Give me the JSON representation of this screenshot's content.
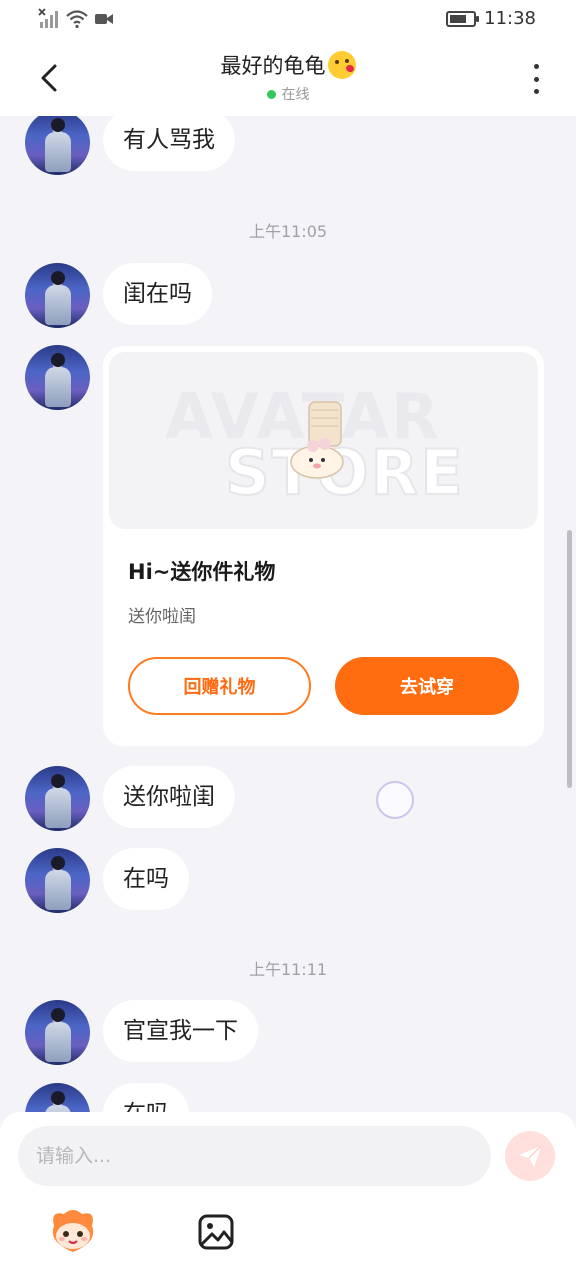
{
  "status_bar": {
    "time": "11:38"
  },
  "header": {
    "title": "最好的龟龟",
    "status": "在线"
  },
  "messages": [
    {
      "text": "有人骂我"
    },
    {
      "time": "上午11:05"
    },
    {
      "text": "闺在吗"
    },
    {
      "gift": {
        "title": "Hi~送你件礼物",
        "message": "送你啦闺",
        "return_label": "回赠礼物",
        "try_label": "去试穿",
        "watermark_top": "AVATAR",
        "watermark_bottom": "STORE"
      }
    },
    {
      "text": "送你啦闺"
    },
    {
      "text": "在吗"
    },
    {
      "time": "上午11:11"
    },
    {
      "text": "官宣我一下"
    },
    {
      "text": "在吗"
    }
  ],
  "input": {
    "placeholder": "请输入..."
  },
  "colors": {
    "accent": "#ff6d10",
    "online": "#34c759",
    "background": "#f4f4f8"
  },
  "icons": [
    "signal-off-icon",
    "wifi-icon",
    "video-icon",
    "battery-icon",
    "back-icon",
    "more-icon",
    "send-icon",
    "emoji-mascot-icon",
    "image-icon"
  ]
}
